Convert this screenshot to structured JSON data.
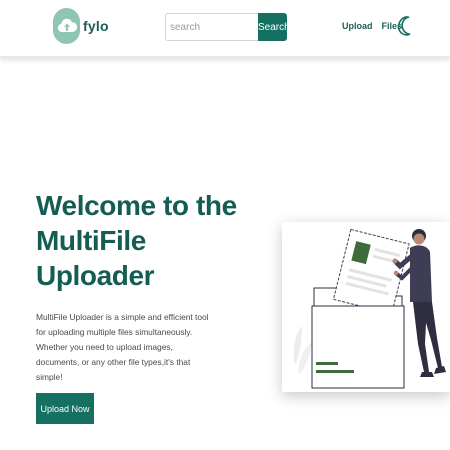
{
  "header": {
    "brand": "fylo",
    "search": {
      "placeholder": "search",
      "button_label": "Search"
    },
    "nav": [
      {
        "label": "Upload"
      },
      {
        "label": "Files"
      }
    ],
    "theme_toggle_icon": "moon-icon"
  },
  "hero": {
    "title": "Welcome to the MultiFile Uploader",
    "description": "MultiFile Uploader is a simple and efficient tool for uploading multiple files simultaneously. Whether you need to upload images, documents, or any other file types,it's that simple!",
    "cta_label": "Upload Now",
    "illustration": "person-uploading-files-illustration"
  },
  "colors": {
    "brand": "#157061",
    "brand_dark": "#155c53",
    "logo_circle": "#8fc5b3",
    "illustration_accent": "#3e6b3a",
    "figure_dark": "#2f2e41"
  }
}
